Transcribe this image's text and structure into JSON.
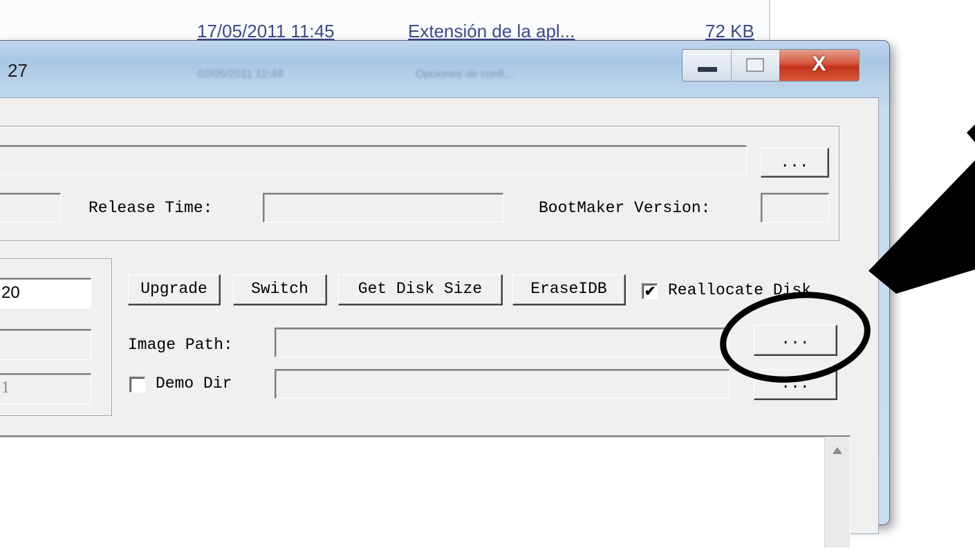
{
  "background_explorer": {
    "row_date": "17/05/2011 11:45",
    "row_type": "Extensión de la apl...",
    "row_size": "72 KB",
    "ghost_date": "02/05/2011 12:48",
    "ghost_type": "Opciones de confi..."
  },
  "window": {
    "title": "27",
    "minimize_icon": "minimize-icon",
    "maximize_icon": "maximize-icon",
    "close_label": "X"
  },
  "top_group": {
    "browse_label": "...",
    "release_time_label": "Release Time:",
    "release_time_value": "",
    "bootmaker_version_label": "BootMaker Version:",
    "bootmaker_version_value": ""
  },
  "left_group": {
    "field1_value": "20",
    "field2_value": "",
    "field3_value": "1"
  },
  "actions": {
    "upgrade_label": "Upgrade",
    "switch_label": "Switch",
    "get_disk_size_label": "Get Disk Size",
    "erase_idb_label": "EraseIDB",
    "reallocate_disk_label": "Reallocate Disk",
    "reallocate_disk_checked": true
  },
  "image_path": {
    "label": "Image Path:",
    "value": "",
    "browse_label": "..."
  },
  "demo_dir": {
    "label": "Demo Dir",
    "checked": false,
    "value": "",
    "browse_label": "..."
  },
  "log": {
    "scroll_up_icon": "scroll-up-arrow-icon"
  },
  "colors": {
    "title_bar": "#a9c6e4",
    "close_button": "#c1331a",
    "dialog_face": "#f0f0f0",
    "annotation": "#000000"
  }
}
